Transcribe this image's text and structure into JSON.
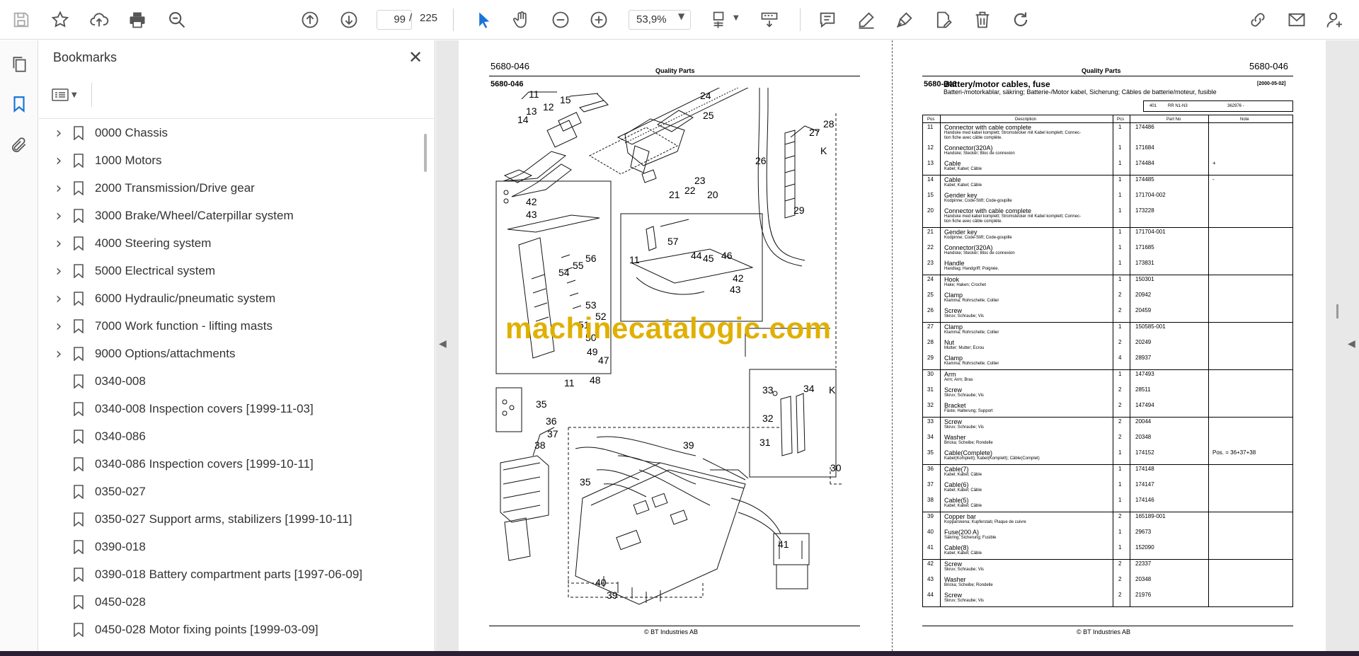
{
  "toolbar": {
    "page_current": "99",
    "page_separator": "/",
    "page_total": "225",
    "zoom": "53,9%"
  },
  "bookmarks": {
    "title": "Bookmarks",
    "items": [
      {
        "label": "0000 Chassis",
        "expandable": true
      },
      {
        "label": "1000 Motors",
        "expandable": true
      },
      {
        "label": "2000 Transmission/Drive gear",
        "expandable": true
      },
      {
        "label": "3000 Brake/Wheel/Caterpillar system",
        "expandable": true
      },
      {
        "label": "4000 Steering system",
        "expandable": true
      },
      {
        "label": "5000 Electrical system",
        "expandable": true
      },
      {
        "label": "6000 Hydraulic/pneumatic system",
        "expandable": true
      },
      {
        "label": "7000 Work function - lifting masts",
        "expandable": true
      },
      {
        "label": "9000 Options/attachments",
        "expandable": true
      },
      {
        "label": "0340-008",
        "expandable": false
      },
      {
        "label": "0340-008 Inspection covers [1999-11-03]",
        "expandable": false
      },
      {
        "label": "0340-086",
        "expandable": false
      },
      {
        "label": "0340-086 Inspection covers [1999-10-11]",
        "expandable": false
      },
      {
        "label": "0350-027",
        "expandable": false
      },
      {
        "label": "0350-027 Support arms, stabilizers [1999-10-11]",
        "expandable": false
      },
      {
        "label": "0390-018",
        "expandable": false
      },
      {
        "label": "0390-018 Battery compartment parts [1997-06-09]",
        "expandable": false
      },
      {
        "label": "0450-028",
        "expandable": false
      },
      {
        "label": "0450-028 Motor fixing points [1999-03-09]",
        "expandable": false
      }
    ]
  },
  "left_page": {
    "code_top": "5680-046",
    "quality": "Quality Parts",
    "code_sub": "5680-046",
    "footer": "© BT Industries AB",
    "callouts": [
      "11",
      "12",
      "13",
      "14",
      "15",
      "24",
      "25",
      "28",
      "27",
      "26",
      "K",
      "23",
      "22",
      "21",
      "20",
      "29",
      "42",
      "43",
      "57",
      "44",
      "45",
      "46",
      "11",
      "56",
      "55",
      "54",
      "42",
      "43",
      "53",
      "52",
      "51",
      "50",
      "49",
      "47",
      "11",
      "48",
      "33",
      "34",
      "K",
      "32",
      "31",
      "30",
      "35",
      "36",
      "37",
      "38",
      "39",
      "35",
      "41",
      "40",
      "39"
    ]
  },
  "right_page": {
    "quality": "Quality Parts",
    "code_top": "5680-046",
    "code": "5680-046",
    "title": "Battery/motor cables, fuse",
    "date": "[2000-05-02]",
    "subtitle": "Batteri-/motorkablar, säkring; Batterie-/Motor kabel, Sicherung; Câbles de batterie/moteur, fusible",
    "info": {
      "a": "401",
      "b": "RR N1-N3",
      "c": "362976 -"
    },
    "headers": {
      "pos": "Pos",
      "desc": "Description",
      "pcs": "Pcs",
      "part": "Part No",
      "note": "Note"
    },
    "footer": "© BT Industries AB",
    "groups": [
      [
        {
          "pos": "11",
          "desc": "Connector with cable complete",
          "trans": [
            "Handske med kabel komplett; Stromstecker mit Kabel komplett; Connec-",
            "tion fiche avec câble complète."
          ],
          "pcs": "1",
          "part": "174486",
          "note": ""
        },
        {
          "pos": "12",
          "desc": "Connector(320A)",
          "trans": [
            "Handske; Stecker; Bloc de connexion"
          ],
          "pcs": "1",
          "part": "171684",
          "note": ""
        },
        {
          "pos": "13",
          "desc": "Cable",
          "trans": [
            "Kabel; Kabel; Câble"
          ],
          "pcs": "1",
          "part": "174484",
          "note": "+"
        }
      ],
      [
        {
          "pos": "14",
          "desc": "Cable",
          "trans": [
            "Kabel; Kabel; Câble"
          ],
          "pcs": "1",
          "part": "174485",
          "note": "-"
        },
        {
          "pos": "15",
          "desc": "Gender key",
          "trans": [
            "Kodpinne; Code-Stift; Code-goupille"
          ],
          "pcs": "1",
          "part": "171704-002",
          "note": ""
        },
        {
          "pos": "20",
          "desc": "Connector with cable complete",
          "trans": [
            "Handske med kabel komplett; Stromstecker mit Kabel komplett; Connec-",
            "tion fiche avec câble complète."
          ],
          "pcs": "1",
          "part": "173228",
          "note": ""
        }
      ],
      [
        {
          "pos": "21",
          "desc": "Gender key",
          "trans": [
            "Kodpinne; Code-Stift; Code-goupille"
          ],
          "pcs": "1",
          "part": "171704-001",
          "note": ""
        },
        {
          "pos": "22",
          "desc": "Connector(320A)",
          "trans": [
            "Handske; Stecker; Bloc de connexion"
          ],
          "pcs": "1",
          "part": "171685",
          "note": ""
        },
        {
          "pos": "23",
          "desc": "Handle",
          "trans": [
            "Handtag; Handgriff; Poignée."
          ],
          "pcs": "1",
          "part": "173831",
          "note": ""
        }
      ],
      [
        {
          "pos": "24",
          "desc": "Hook",
          "trans": [
            "Hake; Haken; Crochet"
          ],
          "pcs": "1",
          "part": "150301",
          "note": ""
        },
        {
          "pos": "25",
          "desc": "Clamp",
          "trans": [
            "Klamma; Rohrschelle; Collier"
          ],
          "pcs": "2",
          "part": "20942",
          "note": ""
        },
        {
          "pos": "26",
          "desc": "Screw",
          "trans": [
            "Skruv; Schraube; Vis"
          ],
          "pcs": "2",
          "part": "20459",
          "note": ""
        }
      ],
      [
        {
          "pos": "27",
          "desc": "Clamp",
          "trans": [
            "Klamma; Rohrschelle; Collier"
          ],
          "pcs": "1",
          "part": "150585-001",
          "note": ""
        },
        {
          "pos": "28",
          "desc": "Nut",
          "trans": [
            "Mutter; Mutter; Ecrou"
          ],
          "pcs": "2",
          "part": "20249",
          "note": ""
        },
        {
          "pos": "29",
          "desc": "Clamp",
          "trans": [
            "Klamma; Rohrschelle; Collier"
          ],
          "pcs": "4",
          "part": "28937",
          "note": ""
        }
      ],
      [
        {
          "pos": "30",
          "desc": "Arm",
          "trans": [
            "Arm; Arm; Bras"
          ],
          "pcs": "1",
          "part": "147493",
          "note": ""
        },
        {
          "pos": "31",
          "desc": "Screw",
          "trans": [
            "Skruv; Schraube; Vis"
          ],
          "pcs": "2",
          "part": "28511",
          "note": ""
        },
        {
          "pos": "32",
          "desc": "Bracket",
          "trans": [
            "Fäste; Halterung; Support"
          ],
          "pcs": "2",
          "part": "147494",
          "note": ""
        }
      ],
      [
        {
          "pos": "33",
          "desc": "Screw",
          "trans": [
            "Skruv; Schraube; Vis"
          ],
          "pcs": "2",
          "part": "20044",
          "note": ""
        },
        {
          "pos": "34",
          "desc": "Washer",
          "trans": [
            "Bricka; Scheibe; Rondelle"
          ],
          "pcs": "2",
          "part": "20348",
          "note": ""
        },
        {
          "pos": "35",
          "desc": "Cable(Complete)",
          "trans": [
            "Kabel(Komplett); Kabel(Komplett); Câble(Complet)"
          ],
          "pcs": "1",
          "part": "174152",
          "note": "Pos. = 36+37+38"
        }
      ],
      [
        {
          "pos": "36",
          "desc": "Cable(7)",
          "trans": [
            "Kabel; Kabel; Câble"
          ],
          "pcs": "1",
          "part": "174148",
          "note": ""
        },
        {
          "pos": "37",
          "desc": "Cable(6)",
          "trans": [
            "Kabel; Kabel; Câble"
          ],
          "pcs": "1",
          "part": "174147",
          "note": ""
        },
        {
          "pos": "38",
          "desc": "Cable(5)",
          "trans": [
            "Kabel; Kabel; Câble"
          ],
          "pcs": "1",
          "part": "174146",
          "note": ""
        }
      ],
      [
        {
          "pos": "39",
          "desc": "Copper bar",
          "trans": [
            "Kopparskena; Kupferstab; Plaque de cuivre"
          ],
          "pcs": "2",
          "part": "165189-001",
          "note": ""
        },
        {
          "pos": "40",
          "desc": "Fuse(200 A)",
          "trans": [
            "Säkring; Sicherung; Fusible"
          ],
          "pcs": "1",
          "part": "29673",
          "note": ""
        },
        {
          "pos": "41",
          "desc": "Cable(8)",
          "trans": [
            "Kabel; Kabel; Câble"
          ],
          "pcs": "1",
          "part": "152090",
          "note": ""
        }
      ],
      [
        {
          "pos": "42",
          "desc": "Screw",
          "trans": [
            "Skruv; Schraube; Vis"
          ],
          "pcs": "2",
          "part": "22337",
          "note": ""
        },
        {
          "pos": "43",
          "desc": "Washer",
          "trans": [
            "Bricka; Scheibe; Rondelle"
          ],
          "pcs": "2",
          "part": "20348",
          "note": ""
        },
        {
          "pos": "44",
          "desc": "Screw",
          "trans": [
            "Skruv; Schraube; Vis"
          ],
          "pcs": "2",
          "part": "21976",
          "note": ""
        }
      ]
    ]
  },
  "watermark": "machinecatalogic.com"
}
